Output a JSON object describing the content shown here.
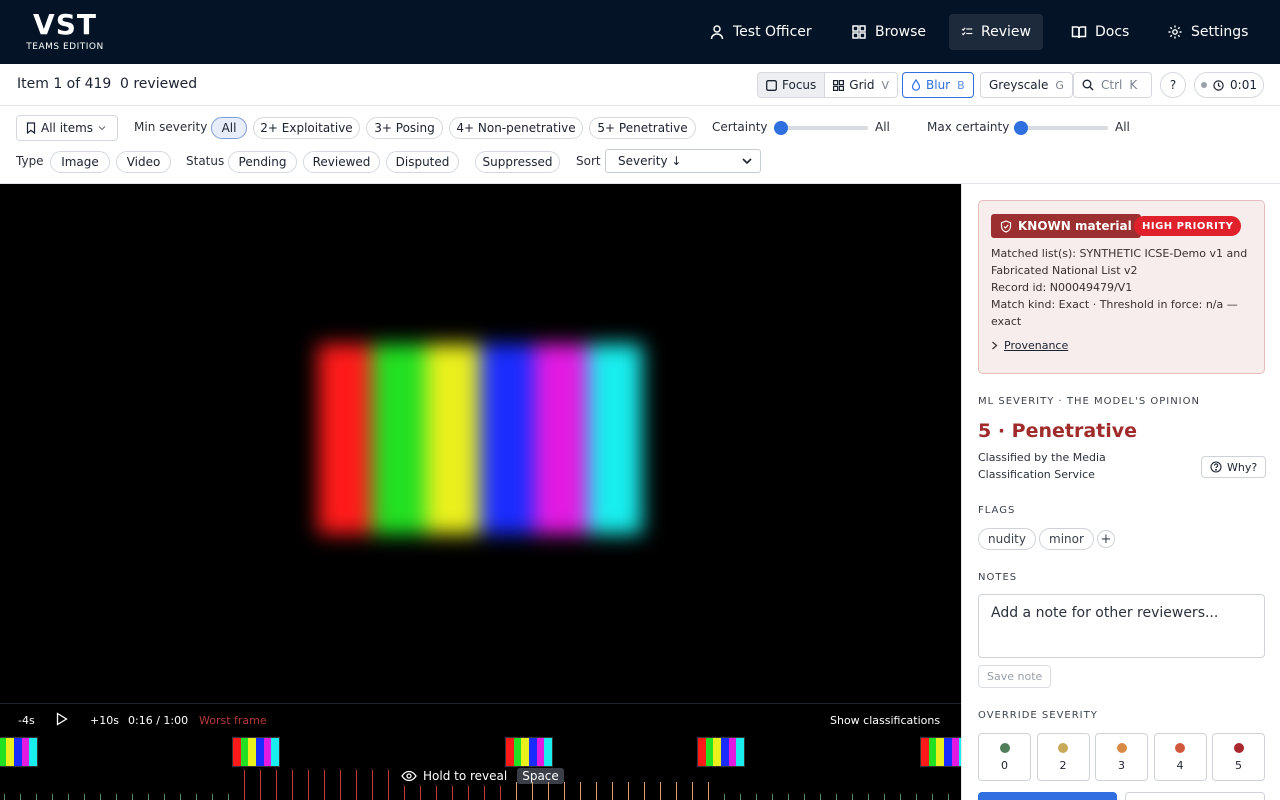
{
  "app": {
    "logo": "VST",
    "edition": "TEAMS EDITION"
  },
  "nav": [
    {
      "label": "Test Officer",
      "icon": "user-icon"
    },
    {
      "label": "Browse",
      "icon": "grid-icon"
    },
    {
      "label": "Review",
      "icon": "checklist-icon",
      "active": true
    },
    {
      "label": "Docs",
      "icon": "book-icon"
    },
    {
      "label": "Settings",
      "icon": "gear-icon"
    }
  ],
  "status": {
    "item_count": "Item 1 of 419",
    "reviewed": "0 reviewed",
    "focus_label": "Focus",
    "focus_key": "",
    "grid_label": "Grid",
    "grid_key": "V",
    "blur_label": "Blur",
    "blur_key": "B",
    "greyscale_label": "Greyscale",
    "greyscale_key": "G",
    "search_label": "Ctrl",
    "search_key": "K",
    "help_label": "?",
    "timer": "0:01"
  },
  "filters": {
    "scope": "All items",
    "min_severity_label": "Min severity",
    "severity_chips": [
      "All",
      "2+ Exploitative",
      "3+ Posing",
      "4+ Non-penetrative",
      "5+ Penetrative"
    ],
    "certainty_label": "Certainty",
    "certainty_value": "All",
    "certainty_level": 0,
    "max_certainty_label": "Max certainty",
    "max_certainty_value": "All",
    "max_certainty_level": 0,
    "type_label": "Type",
    "type_chips": [
      "Image",
      "Video"
    ],
    "status_label": "Status",
    "status_chips": [
      "Pending",
      "Reviewed",
      "Disputed"
    ],
    "suppressed": "Suppressed",
    "sort_label": "Sort",
    "sort_value": "Severity ↓"
  },
  "player": {
    "back": "-4s",
    "forward": "+10s",
    "time": "0:16 / 1:00",
    "worst_frame": "Worst frame",
    "show_classifications": "Show classifications",
    "hold_to_reveal": "Hold to reveal",
    "reveal_key": "Space"
  },
  "panel": {
    "known_label": "KNOWN material",
    "priority_label": "HIGH PRIORITY",
    "matched_lists": "Matched list(s): SYNTHETIC ICSE-Demo v1 and Fabricated National List v2",
    "record_id": "Record id: N00049479/V1",
    "match_kind": "Match kind: Exact · Threshold in force: n/a — exact",
    "provenance": "Provenance",
    "ml_label": "ML SEVERITY · THE MODEL'S OPINION",
    "ml_value": "5 · Penetrative",
    "classified_by": "Classified by the Media Classification Service",
    "why": "Why?",
    "flags_label": "FLAGS",
    "flags": [
      "nudity",
      "minor"
    ],
    "add_flag": "+",
    "notes_label": "NOTES",
    "notes_placeholder": "Add a note for other reviewers...",
    "save_note": "Save note",
    "override_label": "OVERRIDE SEVERITY",
    "override_levels": [
      {
        "value": "0",
        "color": "#4f7d5a"
      },
      {
        "value": "2",
        "color": "#c8a95a"
      },
      {
        "value": "3",
        "color": "#d98a44"
      },
      {
        "value": "4",
        "color": "#d0583c"
      },
      {
        "value": "5",
        "color": "#a8282e"
      }
    ]
  },
  "colors": {
    "nav_bg": "#041426",
    "accent": "#2f6fe0",
    "danger": "#a02b2b",
    "test_bars": [
      "#ff1a1a",
      "#22e022",
      "#eaf01c",
      "#1a2cff",
      "#e21ae2",
      "#19eeee"
    ]
  }
}
